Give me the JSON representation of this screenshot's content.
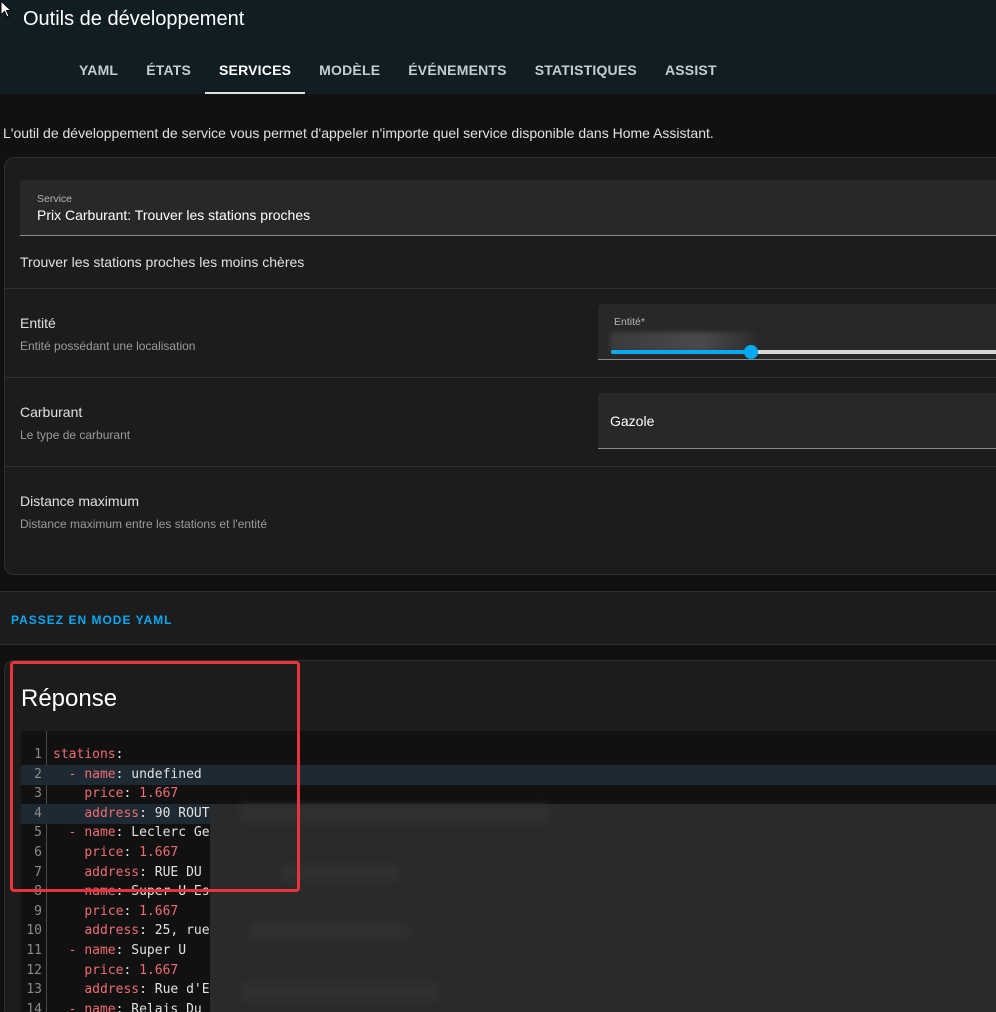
{
  "window": {
    "title": "Outils de développement"
  },
  "tabs": [
    {
      "label": "YAML"
    },
    {
      "label": "ÉTATS"
    },
    {
      "label": "SERVICES",
      "active": true
    },
    {
      "label": "MODÈLE"
    },
    {
      "label": "ÉVÉNEMENTS"
    },
    {
      "label": "STATISTIQUES"
    },
    {
      "label": "ASSIST"
    }
  ],
  "intro": "L'outil de développement de service vous permet d'appeler n'importe quel service disponible dans Home Assistant.",
  "service": {
    "field_label": "Service",
    "value": "Prix Carburant: Trouver les stations proches",
    "description": "Trouver les stations proches les moins chères"
  },
  "fields": {
    "entity": {
      "title": "Entité",
      "subtitle": "Entité possédant une localisation",
      "input_label": "Entité*"
    },
    "fuel": {
      "title": "Carburant",
      "subtitle": "Le type de carburant",
      "value": "Gazole"
    },
    "distance": {
      "title": "Distance maximum",
      "subtitle": "Distance maximum entre les stations et l'entité",
      "slider_fraction": 0.35
    }
  },
  "yaml_mode_button": "PASSEZ EN MODE YAML",
  "response": {
    "title": "Réponse",
    "lines": [
      {
        "n": "1",
        "indent": "",
        "dash": false,
        "key": "stations",
        "value": ""
      },
      {
        "n": "2",
        "indent": "  ",
        "dash": true,
        "key": "name",
        "value": "undefined"
      },
      {
        "n": "3",
        "indent": "    ",
        "dash": false,
        "key": "price",
        "value": "1.667",
        "numeric": true
      },
      {
        "n": "4",
        "indent": "    ",
        "dash": false,
        "key": "address",
        "value": "90 ROUT"
      },
      {
        "n": "5",
        "indent": "  ",
        "dash": true,
        "key": "name",
        "value": "Leclerc Ge"
      },
      {
        "n": "6",
        "indent": "    ",
        "dash": false,
        "key": "price",
        "value": "1.667",
        "numeric": true
      },
      {
        "n": "7",
        "indent": "    ",
        "dash": false,
        "key": "address",
        "value": "RUE DU"
      },
      {
        "n": "8",
        "indent": "  ",
        "dash": true,
        "key": "name",
        "value": "Super U Es"
      },
      {
        "n": "9",
        "indent": "    ",
        "dash": false,
        "key": "price",
        "value": "1.667",
        "numeric": true
      },
      {
        "n": "10",
        "indent": "    ",
        "dash": false,
        "key": "address",
        "value": "25, rue"
      },
      {
        "n": "11",
        "indent": "  ",
        "dash": true,
        "key": "name",
        "value": "Super U"
      },
      {
        "n": "12",
        "indent": "    ",
        "dash": false,
        "key": "price",
        "value": "1.667",
        "numeric": true
      },
      {
        "n": "13",
        "indent": "    ",
        "dash": false,
        "key": "address",
        "value": "Rue d'E"
      },
      {
        "n": "14",
        "indent": "  ",
        "dash": true,
        "key": "name",
        "value": "Relais Du"
      }
    ]
  },
  "colors": {
    "accent": "#03a9f4",
    "highlight_box": "#e8323c",
    "yaml_key": "#ef6b73"
  }
}
